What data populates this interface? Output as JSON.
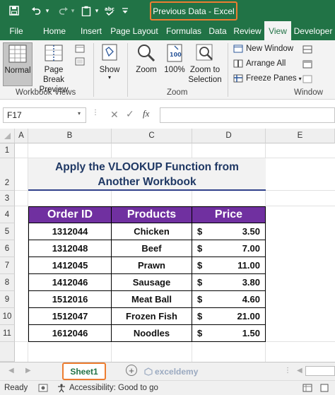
{
  "window": {
    "title": "Previous Data  -  Excel"
  },
  "ribbon_tabs": [
    "File",
    "Home",
    "Insert",
    "Page Layout",
    "Formulas",
    "Data",
    "Review",
    "View",
    "Developer"
  ],
  "active_tab": "View",
  "ribbon": {
    "normal": "Normal",
    "page_break_preview_line1": "Page Break",
    "page_break_preview_line2": "Preview",
    "show": "Show",
    "zoom": "Zoom",
    "zoom_100": "100%",
    "zoom_to_selection_line1": "Zoom to",
    "zoom_to_selection_line2": "Selection",
    "new_window": "New Window",
    "arrange_all": "Arrange All",
    "freeze_panes": "Freeze Panes",
    "group_workbook_views": "Workbook Views",
    "group_zoom": "Zoom",
    "group_window": "Window"
  },
  "formula_bar": {
    "name_box": "F17",
    "fx": "fx",
    "formula": ""
  },
  "columns": [
    "A",
    "B",
    "C",
    "D",
    "E"
  ],
  "rows": [
    "1",
    "2",
    "3",
    "4",
    "5",
    "6",
    "7",
    "8",
    "9",
    "10",
    "11"
  ],
  "sheet": {
    "heading_line1": "Apply the VLOOKUP Function from",
    "heading_line2": "Another Workbook",
    "table_headers": [
      "Order ID",
      "Products",
      "Price"
    ],
    "currency": "$",
    "table_rows": [
      {
        "order_id": "1312044",
        "product": "Chicken",
        "price": "3.50"
      },
      {
        "order_id": "1312048",
        "product": "Beef",
        "price": "7.00"
      },
      {
        "order_id": "1412045",
        "product": "Prawn",
        "price": "11.00"
      },
      {
        "order_id": "1412046",
        "product": "Sausage",
        "price": "3.80"
      },
      {
        "order_id": "1512016",
        "product": "Meat Ball",
        "price": "4.60"
      },
      {
        "order_id": "1512047",
        "product": "Frozen Fish",
        "price": "21.00"
      },
      {
        "order_id": "1612046",
        "product": "Noodles",
        "price": "1.50"
      }
    ]
  },
  "sheet_tabs": {
    "active": "Sheet1",
    "watermark": "exceldemy"
  },
  "status": {
    "ready": "Ready",
    "accessibility": "Accessibility: Good to go"
  },
  "colors": {
    "excel_green": "#217346",
    "highlight_orange": "#ed7d31",
    "table_header_purple": "#7030a0",
    "heading_navy": "#1f3864"
  }
}
